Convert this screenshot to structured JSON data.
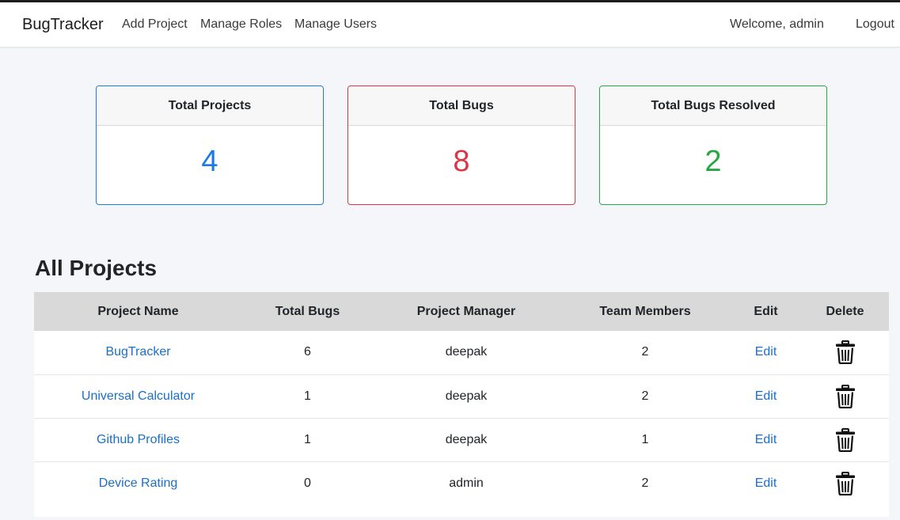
{
  "navbar": {
    "brand": "BugTracker",
    "links": [
      "Add Project",
      "Manage Roles",
      "Manage Users"
    ],
    "welcome": "Welcome, admin",
    "logout": "Logout"
  },
  "stats": [
    {
      "label": "Total Projects",
      "value": "4",
      "color": "#1a7be0"
    },
    {
      "label": "Total Bugs",
      "value": "8",
      "color": "#dc3545"
    },
    {
      "label": "Total Bugs Resolved",
      "value": "2",
      "color": "#28a745"
    }
  ],
  "projects": {
    "title": "All Projects",
    "columns": [
      "Project Name",
      "Total Bugs",
      "Project Manager",
      "Team Members",
      "Edit",
      "Delete"
    ],
    "rows": [
      {
        "name": "BugTracker",
        "bugs": "6",
        "manager": "deepak",
        "members": "2",
        "edit": "Edit"
      },
      {
        "name": "Universal Calculator",
        "bugs": "1",
        "manager": "deepak",
        "members": "2",
        "edit": "Edit"
      },
      {
        "name": "Github Profiles",
        "bugs": "1",
        "manager": "deepak",
        "members": "1",
        "edit": "Edit"
      },
      {
        "name": "Device Rating",
        "bugs": "0",
        "manager": "admin",
        "members": "2",
        "edit": "Edit"
      }
    ],
    "delete_icon": "trash-icon"
  }
}
